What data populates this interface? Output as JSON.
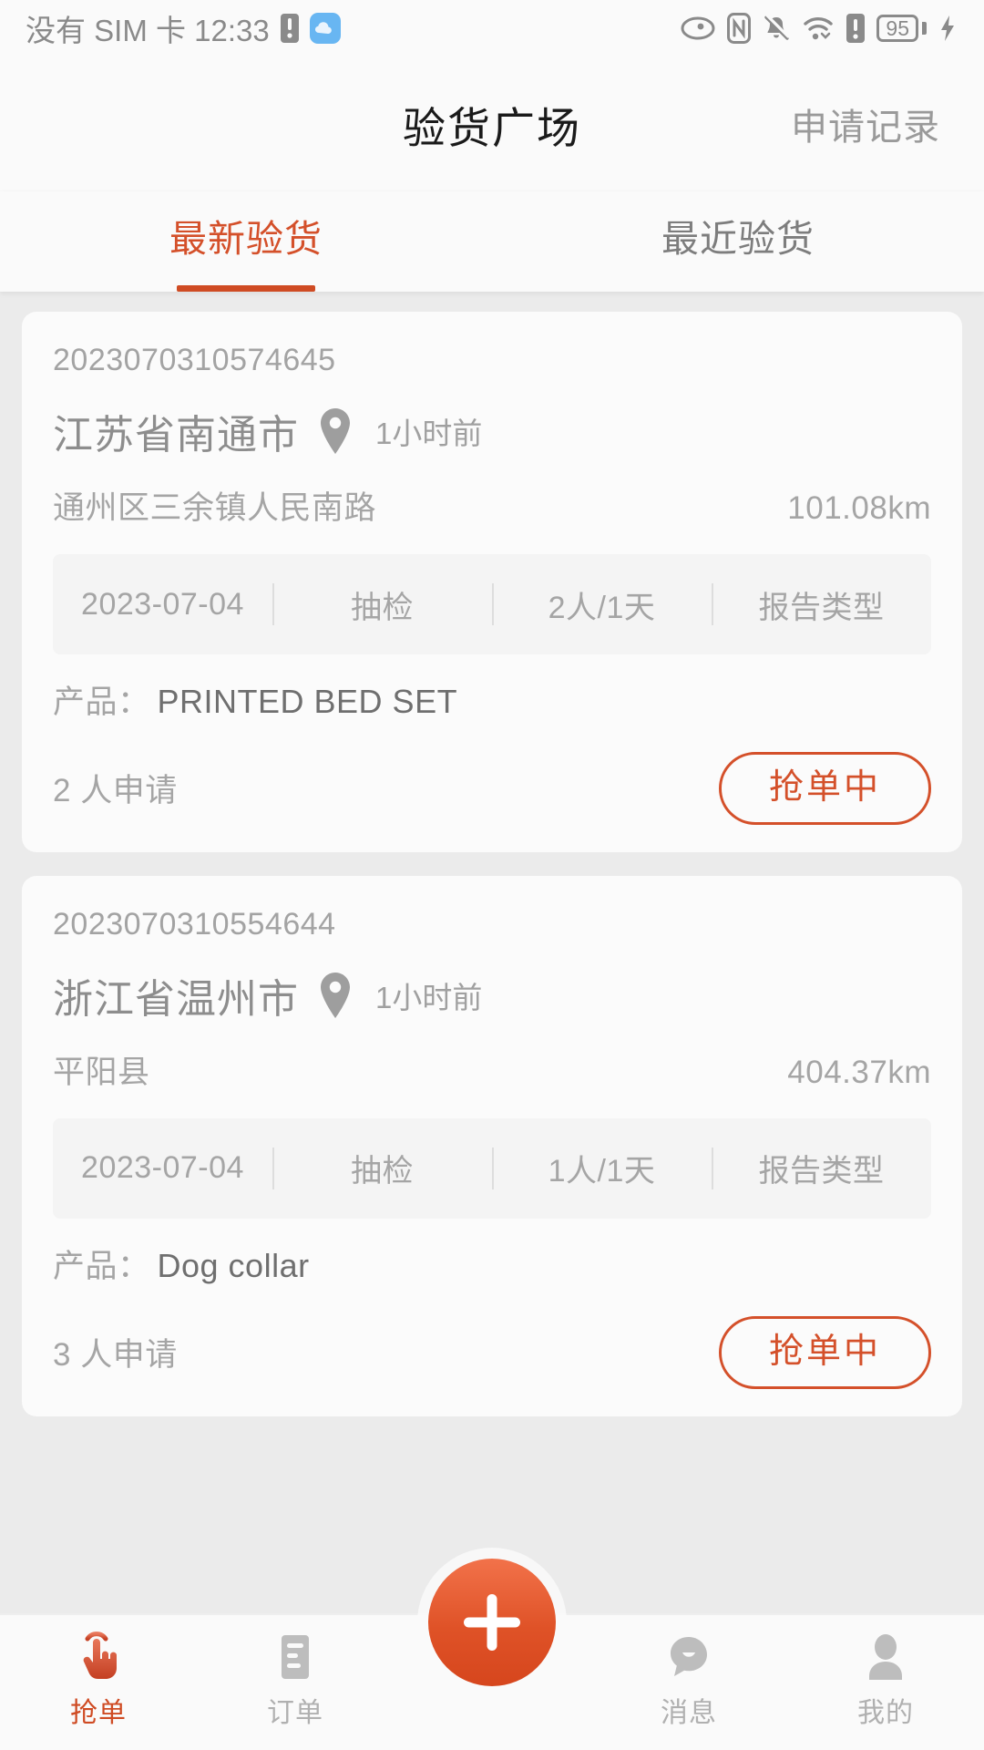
{
  "status_bar": {
    "carrier_time": "没有 SIM 卡 12:33",
    "battery_level": "95",
    "icons": [
      "sim-card-icon",
      "cloud-icon",
      "eye-care-icon",
      "nfc-icon",
      "bell-muted-icon",
      "wifi-icon",
      "sim-alert-icon",
      "battery-icon",
      "charging-bolt-icon"
    ]
  },
  "header": {
    "title": "验货广场",
    "action_label": "申请记录"
  },
  "tabs": [
    {
      "label": "最新验货",
      "active": true
    },
    {
      "label": "最近验货",
      "active": false
    }
  ],
  "cards": [
    {
      "order_no": "2023070310574645",
      "city": "江苏省南通市",
      "time_ago": "1小时前",
      "address": "通州区三余镇人民南路",
      "distance": "101.08km",
      "info": [
        "2023-07-04",
        "抽检",
        "2人/1天",
        "报告类型"
      ],
      "product_label": "产品：",
      "product_value": "PRINTED BED SET",
      "applicants": "2 人申请",
      "button_label": "抢单中"
    },
    {
      "order_no": "2023070310554644",
      "city": "浙江省温州市",
      "time_ago": "1小时前",
      "address": "平阳县",
      "distance": "404.37km",
      "info": [
        "2023-07-04",
        "抽检",
        "1人/1天",
        "报告类型"
      ],
      "product_label": "产品：",
      "product_value": "Dog collar",
      "applicants": "3 人申请",
      "button_label": "抢单中"
    }
  ],
  "bottom_nav": {
    "items": [
      {
        "label": "抢单",
        "icon": "tap-hand-icon",
        "active": true
      },
      {
        "label": "订单",
        "icon": "order-list-icon",
        "active": false
      },
      {
        "label": "消息",
        "icon": "message-smiley-icon",
        "active": false
      },
      {
        "label": "我的",
        "icon": "person-icon",
        "active": false
      }
    ],
    "fab_icon": "plus-icon"
  },
  "colors": {
    "accent": "#d4502a",
    "accent_dark": "#cf4b23",
    "page_bg": "#ebebeb",
    "card_bg": "#fbfbfb",
    "muted_text": "#a5a5a5"
  }
}
